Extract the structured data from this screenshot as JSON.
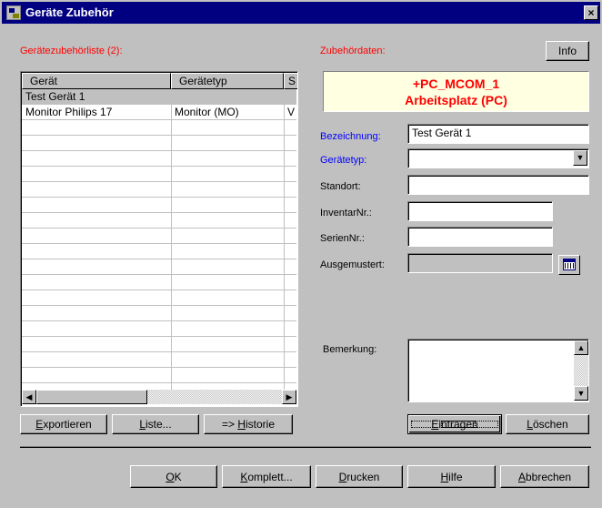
{
  "window": {
    "title": "Geräte Zubehör",
    "close_label": "×"
  },
  "left": {
    "list_title": "Gerätezubehörliste (2):",
    "columns": [
      "Gerät",
      "Gerätetyp",
      "S"
    ],
    "rows": [
      {
        "geraet": "Test Gerät 1",
        "typ": "",
        "s": "",
        "selected": true
      },
      {
        "geraet": "Monitor Philips 17",
        "typ": "Monitor (MO)",
        "s": "V",
        "selected": false
      }
    ],
    "scroll_left_icon": "◀",
    "scroll_right_icon": "▶",
    "buttons": {
      "export": {
        "pre": "E",
        "rest": "xportieren"
      },
      "list": {
        "pre": "L",
        "rest": "iste..."
      },
      "history": {
        "pre": "=> ",
        "hot": "H",
        "rest": "istorie"
      }
    }
  },
  "right": {
    "section_title": "Zubehördaten:",
    "info_label": "Info",
    "device_line1": "+PC_MCOM_1",
    "device_line2": "Arbeitsplatz (PC)",
    "fields": {
      "bezeichnung_label": "Bezeichnung:",
      "bezeichnung_value": "Test Gerät 1",
      "geraetetyp_label": "Gerätetyp:",
      "geraetetyp_value": "",
      "standort_label": "Standort:",
      "standort_value": "",
      "inventar_label": "InventarNr.:",
      "inventar_value": "",
      "serien_label": "SerienNr.:",
      "serien_value": "",
      "ausgemustert_label": "Ausgemustert:",
      "ausgemustert_value": "",
      "bemerkung_label": "Bemerkung:",
      "bemerkung_value": ""
    },
    "combo_arrow": "▼",
    "memo_up": "▲",
    "memo_down": "▼",
    "buttons": {
      "eintragen": {
        "pre": "E",
        "rest": "intragen"
      },
      "loeschen": {
        "pre": "L",
        "rest": "öschen"
      }
    }
  },
  "bottom": {
    "ok": {
      "pre": "O",
      "rest": "K"
    },
    "komplett": {
      "pre": "K",
      "rest": "omplett..."
    },
    "drucken": {
      "pre": "D",
      "rest": "rucken"
    },
    "hilfe": {
      "pre": "H",
      "rest": "ilfe"
    },
    "abbrechen": {
      "pre": "A",
      "rest": "bbrechen"
    }
  },
  "colors": {
    "titlebar": "#000080",
    "accent_red": "#ff0000",
    "accent_blue": "#0000ff",
    "tooltip_bg": "#ffffe1",
    "face": "#c0c0c0"
  }
}
